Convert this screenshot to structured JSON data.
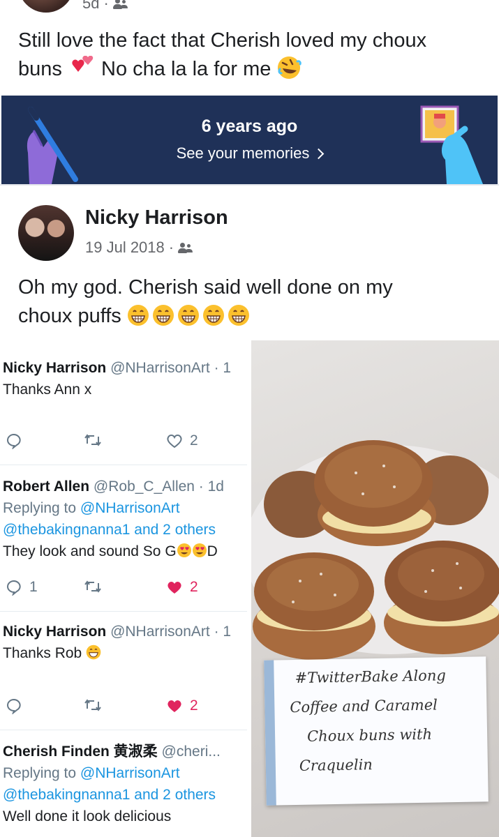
{
  "top_post": {
    "time": "5d",
    "text_line1": "Still love the fact that Cherish loved my choux",
    "text_line2_a": "buns",
    "text_line2_b": "No cha la la for me"
  },
  "memories": {
    "title": "6 years ago",
    "link": "See your memories"
  },
  "post": {
    "author": "Nicky Harrison",
    "date": "19 Jul 2018",
    "text_line1": "Oh my god. Cherish said well done on my",
    "text_line2": "choux puffs"
  },
  "tweets": [
    {
      "name": "Nicky Harrison",
      "handle": "@NHarrisonArt · 1",
      "text": "Thanks Ann x",
      "likes": "2"
    },
    {
      "name": "Robert Allen",
      "handle": "@Rob_C_Allen · 1d",
      "reply_prefix": "Replying to",
      "reply_to_1": "@NHarrisonArt",
      "reply_to_2": "@thebakingnanna1 and 2 others",
      "text_a": "They look and sound So G",
      "text_b": "D",
      "replies": "1",
      "likes": "2"
    },
    {
      "name": "Nicky Harrison",
      "handle": "@NHarrisonArt · 1",
      "text": "Thanks Rob",
      "likes": "2"
    },
    {
      "name": "Cherish Finden 黄淑柔",
      "handle": "@cheri...",
      "reply_prefix": "Replying to",
      "reply_to_1": "@NHarrisonArt",
      "reply_to_2": "@thebakingnanna1 and 2 others",
      "text": "Well done it look delicious"
    }
  ],
  "note": {
    "line1": "#TwitterBake Along",
    "line2": "Coffee and Caramel",
    "line3": "Choux buns with",
    "line4": "Craquelin"
  },
  "colors": {
    "banner": "#1f3158",
    "twitter_blue": "#1b95e0",
    "like_red": "#e0245e",
    "meta_grey": "#65676b"
  }
}
